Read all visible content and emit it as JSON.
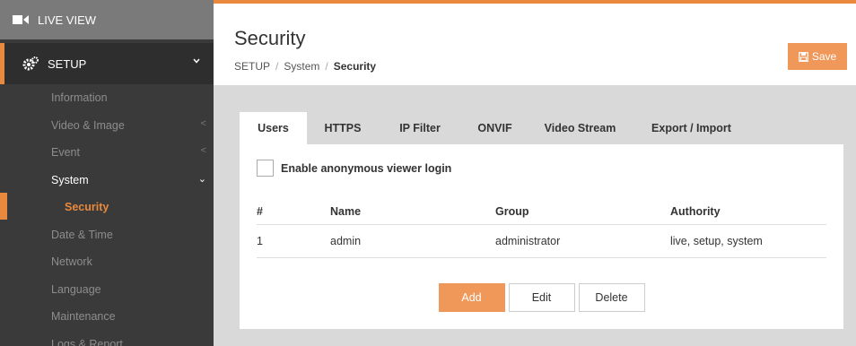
{
  "sidebar": {
    "live_view": "LIVE VIEW",
    "setup": "SETUP",
    "items": [
      {
        "label": "Information"
      },
      {
        "label": "Video & Image",
        "arrow": "<"
      },
      {
        "label": "Event",
        "arrow": "<"
      },
      {
        "label": "System",
        "arrow": "⌄"
      },
      {
        "label": "Security"
      },
      {
        "label": "Date & Time"
      },
      {
        "label": "Network"
      },
      {
        "label": "Language"
      },
      {
        "label": "Maintenance"
      },
      {
        "label": "Logs & Report"
      }
    ]
  },
  "header": {
    "title": "Security",
    "breadcrumb": [
      "SETUP",
      "System",
      "Security"
    ],
    "save_label": "Save"
  },
  "tabs": [
    "Users",
    "HTTPS",
    "IP Filter",
    "ONVIF",
    "Video Stream",
    "Export / Import"
  ],
  "users": {
    "anonymous_label": "Enable anonymous viewer login",
    "columns": [
      "#",
      "Name",
      "Group",
      "Authority"
    ],
    "rows": [
      {
        "num": "1",
        "name": "admin",
        "group": "administrator",
        "authority": "live, setup, system"
      }
    ],
    "buttons": {
      "add": "Add",
      "edit": "Edit",
      "delete": "Delete"
    }
  },
  "colors": {
    "accent": "#e8893d",
    "button": "#f0975a"
  }
}
